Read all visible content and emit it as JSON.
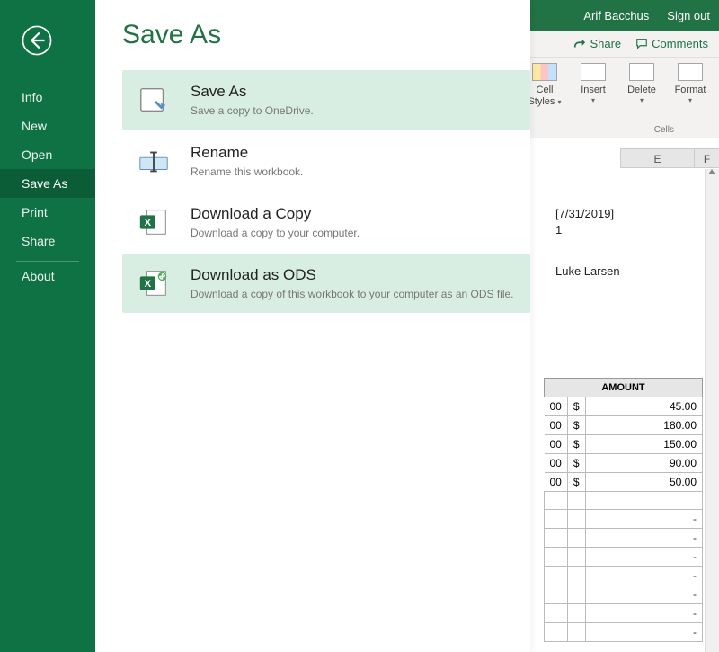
{
  "account": {
    "user": "Arif Bacchus",
    "signout": "Sign out"
  },
  "ribbon": {
    "share": "Share",
    "comments": "Comments"
  },
  "tools": {
    "cell_styles": "Cell Styles",
    "insert": "Insert",
    "delete": "Delete",
    "format": "Format",
    "group": "Cells"
  },
  "columns": {
    "e": "E",
    "f": "F"
  },
  "cells": {
    "date": "[7/31/2019]",
    "one": "1",
    "name": "Luke Larsen"
  },
  "amount": {
    "header": "AMOUNT",
    "rows": [
      {
        "overflow": "00",
        "currency": "$",
        "value": "45.00"
      },
      {
        "overflow": "00",
        "currency": "$",
        "value": "180.00"
      },
      {
        "overflow": "00",
        "currency": "$",
        "value": "150.00"
      },
      {
        "overflow": "00",
        "currency": "$",
        "value": "90.00"
      },
      {
        "overflow": "00",
        "currency": "$",
        "value": "50.00"
      }
    ],
    "dashes": [
      "-",
      "-",
      "-",
      "-",
      "-",
      "-",
      "-"
    ]
  },
  "backstage": {
    "title": "Save As",
    "sidebar": {
      "info": "Info",
      "new": "New",
      "open": "Open",
      "save_as": "Save As",
      "print": "Print",
      "share": "Share",
      "about": "About"
    },
    "options": {
      "save_as": {
        "title": "Save As",
        "desc": "Save a copy to OneDrive."
      },
      "rename": {
        "title": "Rename",
        "desc": "Rename this workbook."
      },
      "download_copy": {
        "title": "Download a Copy",
        "desc": "Download a copy to your computer."
      },
      "download_ods": {
        "title": "Download as ODS",
        "desc": "Download a copy of this workbook to your computer as an ODS file."
      }
    }
  }
}
